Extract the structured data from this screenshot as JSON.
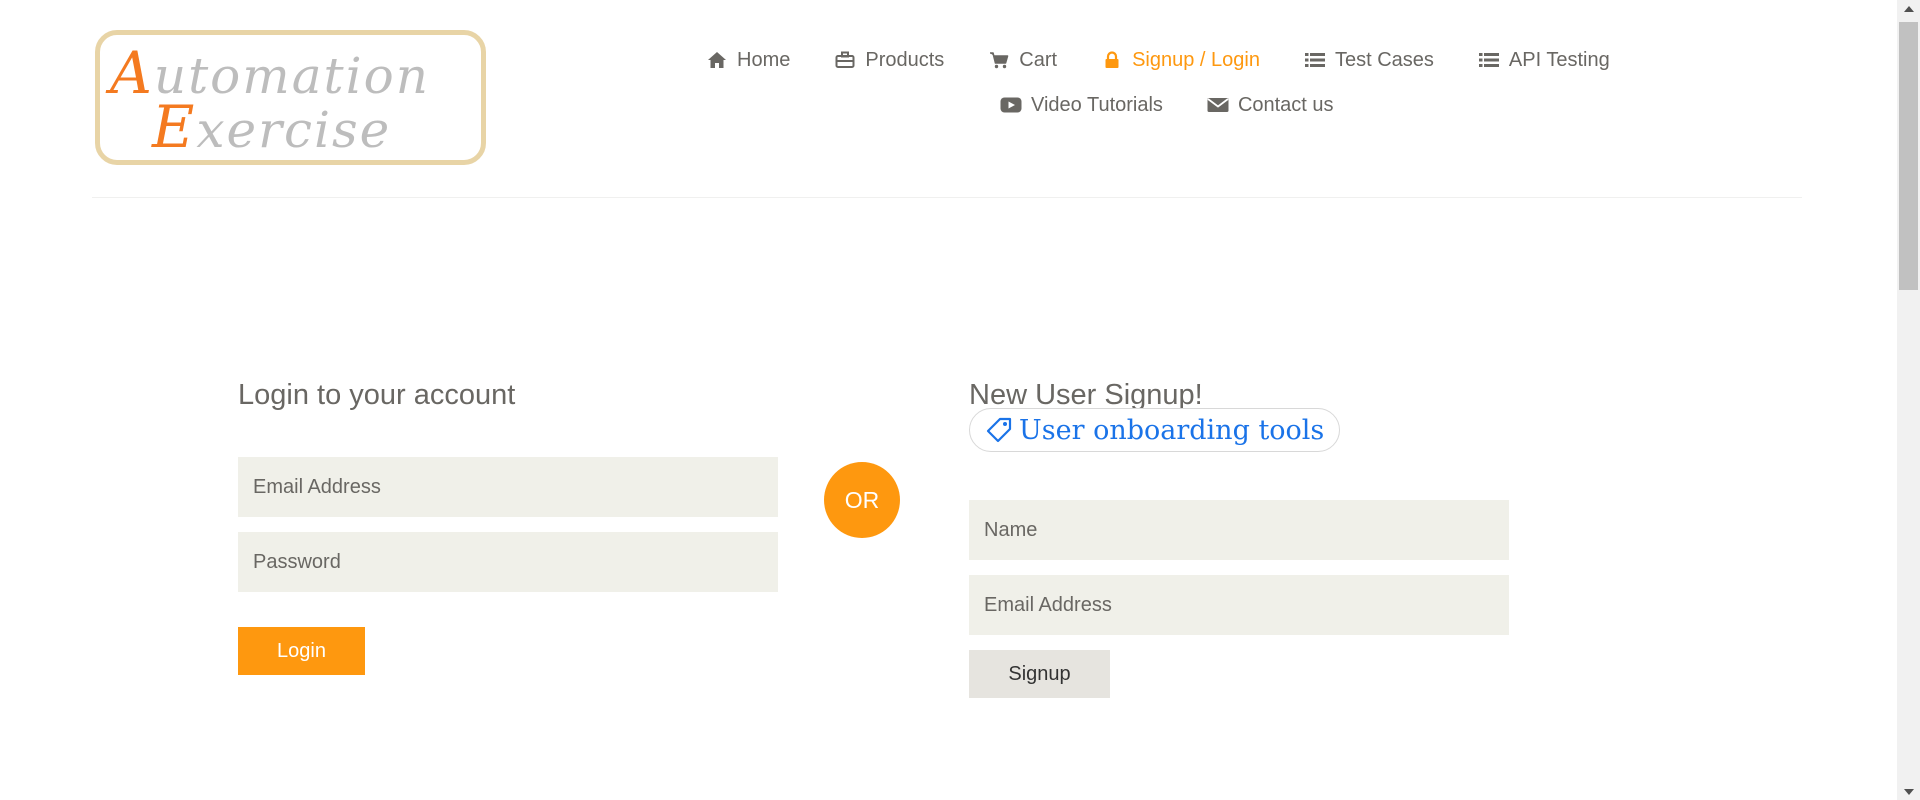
{
  "logo": {
    "text_line1": "Automation",
    "text_line2": "Exercise"
  },
  "nav": {
    "row1": [
      {
        "label": "Home",
        "icon": "home-icon"
      },
      {
        "label": "Products",
        "icon": "products-icon"
      },
      {
        "label": "Cart",
        "icon": "cart-icon"
      },
      {
        "label": "Signup / Login",
        "icon": "lock-icon",
        "active": true
      },
      {
        "label": "Test Cases",
        "icon": "list-icon"
      },
      {
        "label": "API Testing",
        "icon": "list-icon"
      }
    ],
    "row2": [
      {
        "label": "Video Tutorials",
        "icon": "youtube-icon"
      },
      {
        "label": "Contact us",
        "icon": "envelope-icon"
      }
    ]
  },
  "login": {
    "title": "Login to your account",
    "email_placeholder": "Email Address",
    "password_placeholder": "Password",
    "button": "Login"
  },
  "or_label": "OR",
  "signup": {
    "title": "New User Signup!",
    "tag_label": "User onboarding tools",
    "name_placeholder": "Name",
    "email_placeholder": "Email Address",
    "button": "Signup"
  },
  "colors": {
    "accent": "#fe980f",
    "nav_text": "#696763",
    "input_bg": "#f0f0e9",
    "tag_link": "#1a73e8"
  }
}
